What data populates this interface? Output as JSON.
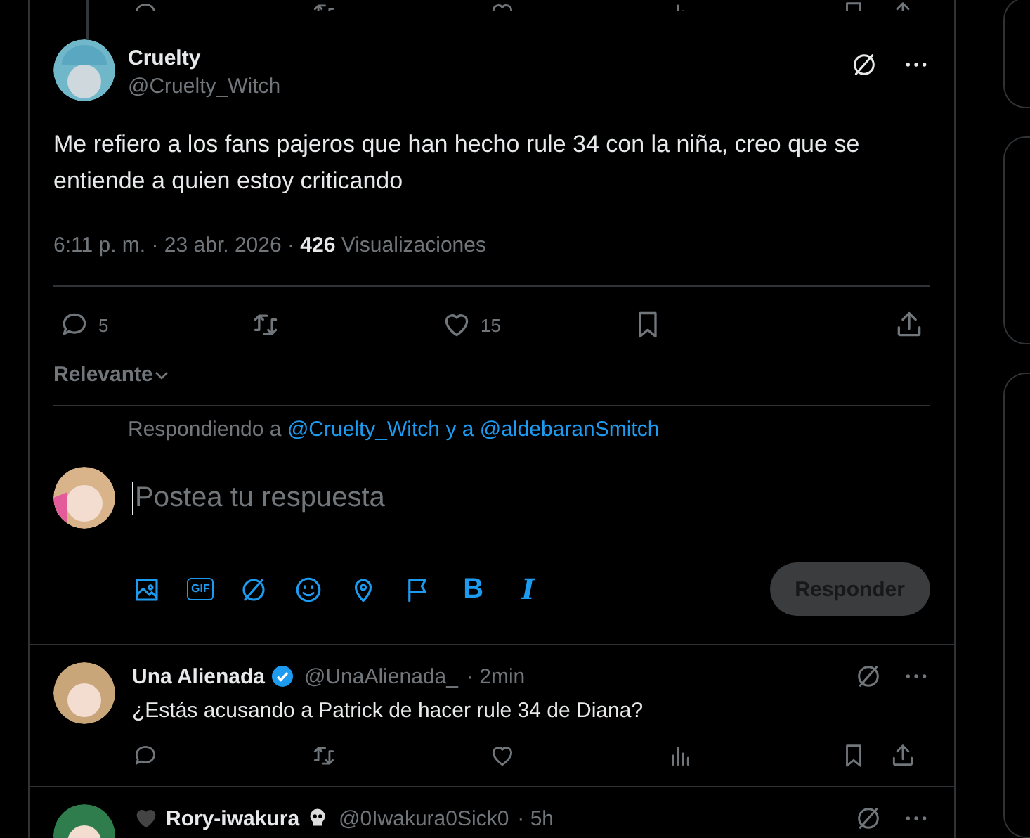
{
  "thread_above": {
    "actions": [
      {
        "kind": "reply"
      },
      {
        "kind": "repost"
      },
      {
        "kind": "like"
      },
      {
        "kind": "views"
      },
      {
        "kind": "bookmark"
      },
      {
        "kind": "share"
      }
    ]
  },
  "tweet": {
    "name": "Cruelty",
    "handle": "@Cruelty_Witch",
    "text": "Me refiero a los fans pajeros que han hecho rule 34 con la niña, creo que se entiende a quien estoy criticando",
    "meta": "6:11 p. m. · 23 abr. 2026 · **426** Visualizaciones",
    "actions": [
      {
        "kind": "reply",
        "count": "5"
      },
      {
        "kind": "repost"
      },
      {
        "kind": "like",
        "count": "15"
      },
      {
        "kind": "bookmark"
      },
      {
        "kind": "share"
      }
    ]
  },
  "sort": "Relevante",
  "composer": {
    "prefix": "Respondiendo a",
    "mentions": [
      "@Cruelty_Witch",
      "@aldebaranSmitch"
    ],
    "joiner": "y a",
    "placeholder": "Postea tu respuesta",
    "tools": [
      {
        "kind": "image"
      },
      {
        "kind": "gif",
        "label": "GIF"
      },
      {
        "kind": "grok"
      },
      {
        "kind": "emoji"
      },
      {
        "kind": "location"
      },
      {
        "kind": "flag"
      },
      {
        "kind": "bold",
        "label": "B"
      },
      {
        "kind": "italic",
        "label": "I"
      }
    ],
    "button": {
      "label": "Responder",
      "disabled": true
    }
  },
  "replies": [
    {
      "name": "Una Alienada",
      "verified": true,
      "handle": "@UnaAlienada_",
      "time": "· 2min",
      "text": "¿Estás acusando a Patrick de hacer rule 34 de Diana?",
      "actions": [
        {
          "kind": "reply"
        },
        {
          "kind": "repost"
        },
        {
          "kind": "like"
        },
        {
          "kind": "views"
        },
        {
          "kind": "bookmark"
        },
        {
          "kind": "share"
        }
      ]
    },
    {
      "name": "Rory-iwakura",
      "handle": "@0Iwakura0Sick0",
      "time": "· 5h"
    }
  ]
}
